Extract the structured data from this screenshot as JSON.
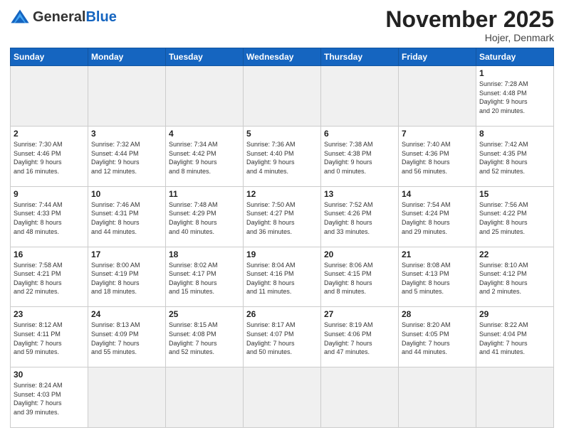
{
  "header": {
    "logo_general": "General",
    "logo_blue": "Blue",
    "month_title": "November 2025",
    "location": "Hojer, Denmark"
  },
  "days_of_week": [
    "Sunday",
    "Monday",
    "Tuesday",
    "Wednesday",
    "Thursday",
    "Friday",
    "Saturday"
  ],
  "weeks": [
    [
      {
        "day": "",
        "info": "",
        "empty": true
      },
      {
        "day": "",
        "info": "",
        "empty": true
      },
      {
        "day": "",
        "info": "",
        "empty": true
      },
      {
        "day": "",
        "info": "",
        "empty": true
      },
      {
        "day": "",
        "info": "",
        "empty": true
      },
      {
        "day": "",
        "info": "",
        "empty": true
      },
      {
        "day": "1",
        "info": "Sunrise: 7:28 AM\nSunset: 4:48 PM\nDaylight: 9 hours\nand 20 minutes."
      }
    ],
    [
      {
        "day": "2",
        "info": "Sunrise: 7:30 AM\nSunset: 4:46 PM\nDaylight: 9 hours\nand 16 minutes."
      },
      {
        "day": "3",
        "info": "Sunrise: 7:32 AM\nSunset: 4:44 PM\nDaylight: 9 hours\nand 12 minutes."
      },
      {
        "day": "4",
        "info": "Sunrise: 7:34 AM\nSunset: 4:42 PM\nDaylight: 9 hours\nand 8 minutes."
      },
      {
        "day": "5",
        "info": "Sunrise: 7:36 AM\nSunset: 4:40 PM\nDaylight: 9 hours\nand 4 minutes."
      },
      {
        "day": "6",
        "info": "Sunrise: 7:38 AM\nSunset: 4:38 PM\nDaylight: 9 hours\nand 0 minutes."
      },
      {
        "day": "7",
        "info": "Sunrise: 7:40 AM\nSunset: 4:36 PM\nDaylight: 8 hours\nand 56 minutes."
      },
      {
        "day": "8",
        "info": "Sunrise: 7:42 AM\nSunset: 4:35 PM\nDaylight: 8 hours\nand 52 minutes."
      }
    ],
    [
      {
        "day": "9",
        "info": "Sunrise: 7:44 AM\nSunset: 4:33 PM\nDaylight: 8 hours\nand 48 minutes."
      },
      {
        "day": "10",
        "info": "Sunrise: 7:46 AM\nSunset: 4:31 PM\nDaylight: 8 hours\nand 44 minutes."
      },
      {
        "day": "11",
        "info": "Sunrise: 7:48 AM\nSunset: 4:29 PM\nDaylight: 8 hours\nand 40 minutes."
      },
      {
        "day": "12",
        "info": "Sunrise: 7:50 AM\nSunset: 4:27 PM\nDaylight: 8 hours\nand 36 minutes."
      },
      {
        "day": "13",
        "info": "Sunrise: 7:52 AM\nSunset: 4:26 PM\nDaylight: 8 hours\nand 33 minutes."
      },
      {
        "day": "14",
        "info": "Sunrise: 7:54 AM\nSunset: 4:24 PM\nDaylight: 8 hours\nand 29 minutes."
      },
      {
        "day": "15",
        "info": "Sunrise: 7:56 AM\nSunset: 4:22 PM\nDaylight: 8 hours\nand 25 minutes."
      }
    ],
    [
      {
        "day": "16",
        "info": "Sunrise: 7:58 AM\nSunset: 4:21 PM\nDaylight: 8 hours\nand 22 minutes."
      },
      {
        "day": "17",
        "info": "Sunrise: 8:00 AM\nSunset: 4:19 PM\nDaylight: 8 hours\nand 18 minutes."
      },
      {
        "day": "18",
        "info": "Sunrise: 8:02 AM\nSunset: 4:17 PM\nDaylight: 8 hours\nand 15 minutes."
      },
      {
        "day": "19",
        "info": "Sunrise: 8:04 AM\nSunset: 4:16 PM\nDaylight: 8 hours\nand 11 minutes."
      },
      {
        "day": "20",
        "info": "Sunrise: 8:06 AM\nSunset: 4:15 PM\nDaylight: 8 hours\nand 8 minutes."
      },
      {
        "day": "21",
        "info": "Sunrise: 8:08 AM\nSunset: 4:13 PM\nDaylight: 8 hours\nand 5 minutes."
      },
      {
        "day": "22",
        "info": "Sunrise: 8:10 AM\nSunset: 4:12 PM\nDaylight: 8 hours\nand 2 minutes."
      }
    ],
    [
      {
        "day": "23",
        "info": "Sunrise: 8:12 AM\nSunset: 4:11 PM\nDaylight: 7 hours\nand 59 minutes."
      },
      {
        "day": "24",
        "info": "Sunrise: 8:13 AM\nSunset: 4:09 PM\nDaylight: 7 hours\nand 55 minutes."
      },
      {
        "day": "25",
        "info": "Sunrise: 8:15 AM\nSunset: 4:08 PM\nDaylight: 7 hours\nand 52 minutes."
      },
      {
        "day": "26",
        "info": "Sunrise: 8:17 AM\nSunset: 4:07 PM\nDaylight: 7 hours\nand 50 minutes."
      },
      {
        "day": "27",
        "info": "Sunrise: 8:19 AM\nSunset: 4:06 PM\nDaylight: 7 hours\nand 47 minutes."
      },
      {
        "day": "28",
        "info": "Sunrise: 8:20 AM\nSunset: 4:05 PM\nDaylight: 7 hours\nand 44 minutes."
      },
      {
        "day": "29",
        "info": "Sunrise: 8:22 AM\nSunset: 4:04 PM\nDaylight: 7 hours\nand 41 minutes."
      }
    ],
    [
      {
        "day": "30",
        "info": "Sunrise: 8:24 AM\nSunset: 4:03 PM\nDaylight: 7 hours\nand 39 minutes."
      },
      {
        "day": "",
        "info": "",
        "empty": true
      },
      {
        "day": "",
        "info": "",
        "empty": true
      },
      {
        "day": "",
        "info": "",
        "empty": true
      },
      {
        "day": "",
        "info": "",
        "empty": true
      },
      {
        "day": "",
        "info": "",
        "empty": true
      },
      {
        "day": "",
        "info": "",
        "empty": true
      }
    ]
  ]
}
